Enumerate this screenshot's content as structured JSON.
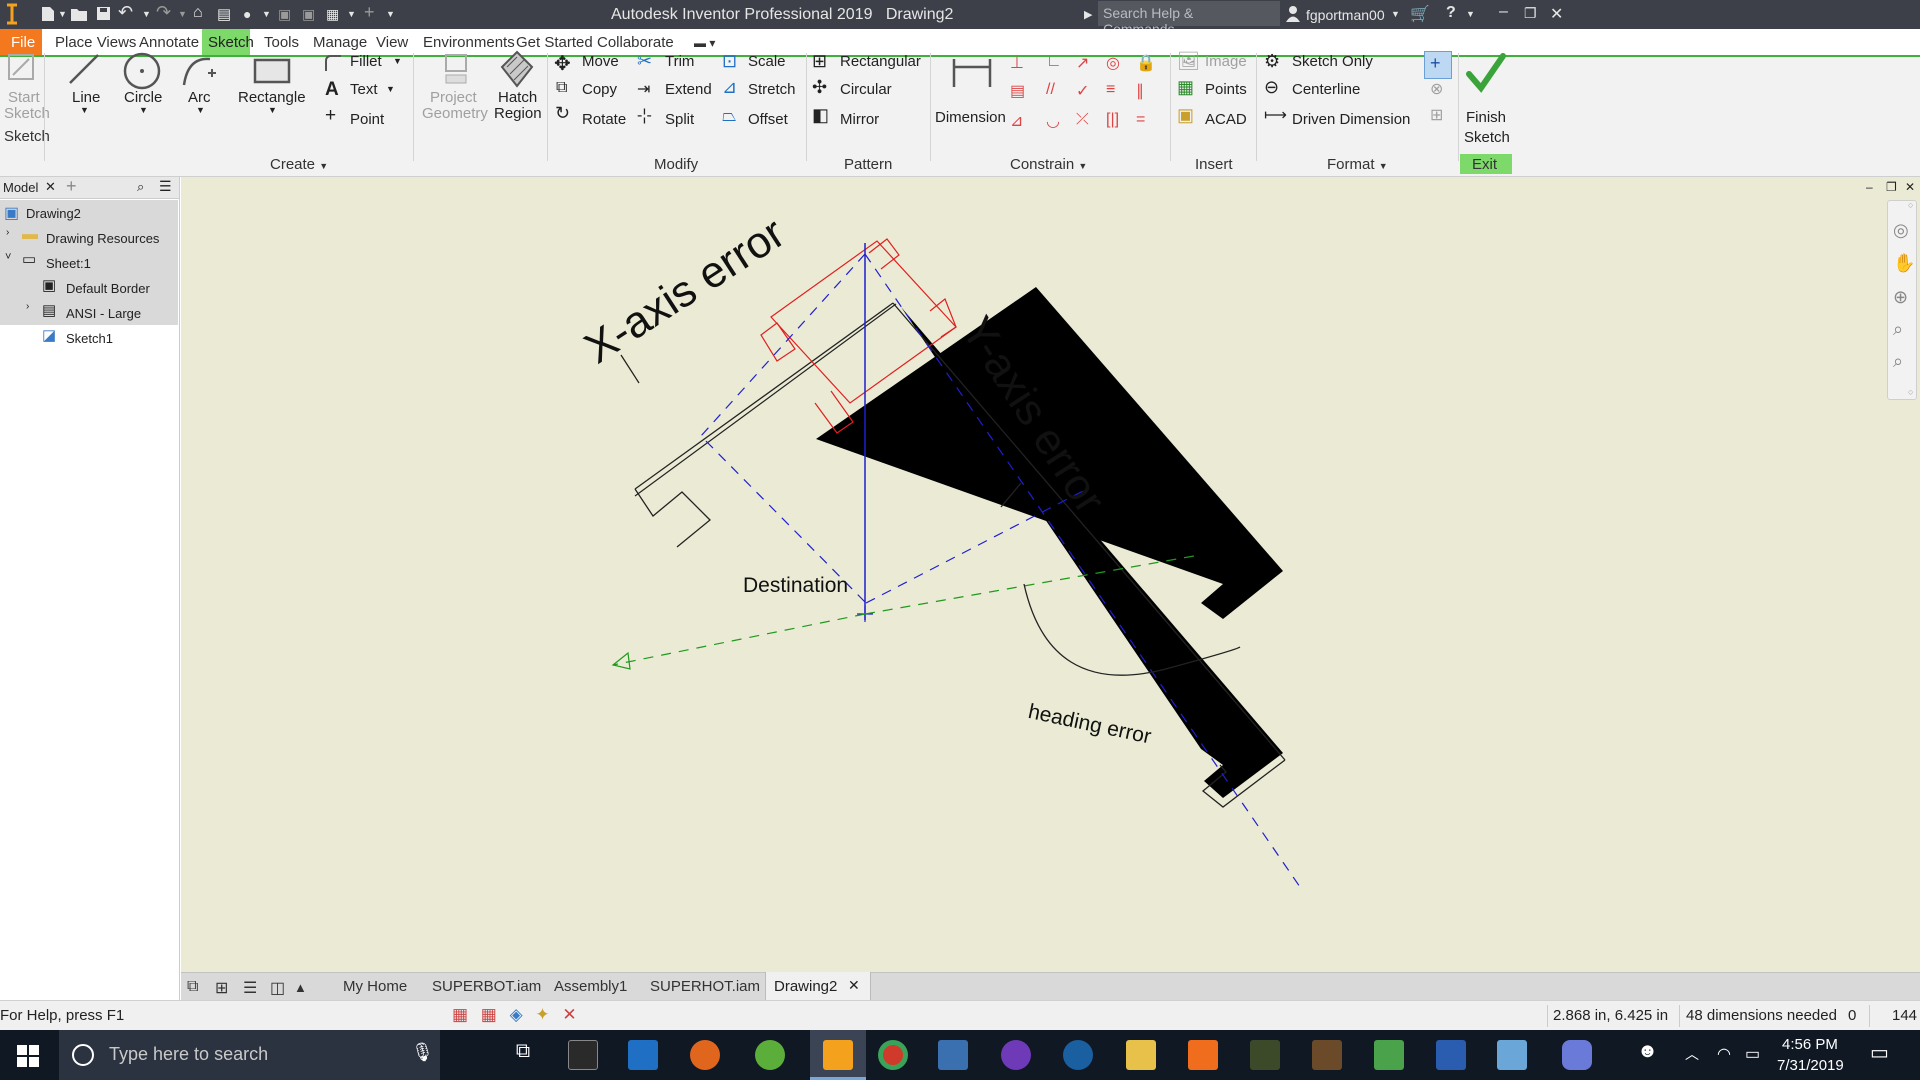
{
  "titlebar": {
    "app_title": "Autodesk Inventor Professional 2019",
    "document_name": "Drawing2",
    "search_placeholder": "Search Help & Commands...",
    "user": "fgportman00"
  },
  "menu": {
    "file": "File",
    "tabs": [
      "Place Views",
      "Annotate",
      "Sketch",
      "Tools",
      "Manage",
      "View",
      "Environments",
      "Get Started",
      "Collaborate"
    ],
    "active_tab": "Sketch"
  },
  "ribbon": {
    "start_sketch": [
      "Start",
      "Sketch"
    ],
    "line": "Line",
    "circle": "Circle",
    "arc": "Arc",
    "rectangle": "Rectangle",
    "fillet": "Fillet",
    "text": "Text",
    "point": "Point",
    "project_geometry": [
      "Project",
      "Geometry"
    ],
    "hatch_region": [
      "Hatch",
      "Region"
    ],
    "move": "Move",
    "copy": "Copy",
    "rotate": "Rotate",
    "trim": "Trim",
    "extend": "Extend",
    "split": "Split",
    "scale": "Scale",
    "stretch": "Stretch",
    "offset": "Offset",
    "rectangular": "Rectangular",
    "circular": "Circular",
    "mirror": "Mirror",
    "dimension": "Dimension",
    "image": "Image",
    "points": "Points",
    "acad": "ACAD",
    "sketch_only": "Sketch Only",
    "centerline": "Centerline",
    "driven_dimension": "Driven Dimension",
    "finish_sketch": [
      "Finish",
      "Sketch"
    ],
    "groups": {
      "sketch": "Sketch",
      "create": "Create",
      "modify": "Modify",
      "pattern": "Pattern",
      "constrain": "Constrain",
      "insert": "Insert",
      "format": "Format",
      "exit": "Exit"
    }
  },
  "browser": {
    "tab": "Model",
    "nodes": [
      "Drawing2",
      "Drawing Resources",
      "Sheet:1",
      "Default Border",
      "ANSI - Large",
      "Sketch1"
    ]
  },
  "canvas": {
    "labels": {
      "x_axis": "X-axis error",
      "y_axis": "Y-axis error",
      "destination": "Destination",
      "heading": "heading error"
    }
  },
  "doc_tabs": [
    "My Home",
    "SUPERBOT.iam",
    "Assembly1",
    "SUPERHOT.iam",
    "Drawing2"
  ],
  "status": {
    "help": "For Help, press F1",
    "coords": "2.868 in, 6.425 in",
    "dimensions": "48 dimensions needed",
    "count_a": "0",
    "count_b": "144"
  },
  "taskbar": {
    "search_placeholder": "Type here to search",
    "time": "4:56 PM",
    "date": "7/31/2019"
  },
  "colors": {
    "titlebar": "#3d4049",
    "file_tab": "#f4781e",
    "active_tab": "#7dd96a",
    "canvas": "#ebebd5",
    "sketch_blue": "#1f1fd0",
    "sketch_red": "#e02020",
    "sketch_green": "#1e9a1e"
  }
}
